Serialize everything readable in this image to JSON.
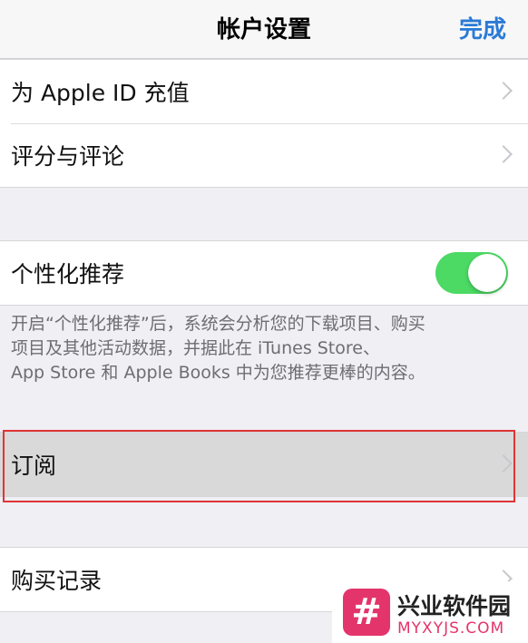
{
  "header": {
    "title": "帐户设置",
    "done_label": "完成"
  },
  "group1": {
    "items": [
      {
        "label": "为 Apple ID 充值"
      },
      {
        "label": "评分与评论"
      }
    ]
  },
  "personalize": {
    "label": "个性化推荐",
    "toggle_on": true,
    "toggle_color": "#4cd964",
    "footnote_lines": [
      "开启“个性化推荐”后，系统会分析您的下载项目、购买",
      "项目及其他活动数据，并据此在 iTunes Store、",
      "App Store 和 Apple Books 中为您推荐更棒的内容。"
    ]
  },
  "subscriptions": {
    "label": "订阅",
    "highlight_color": "#e03434"
  },
  "purchase_history": {
    "label": "购买记录"
  },
  "watermark": {
    "logo_symbol": "#",
    "title": "兴业软件园",
    "url": "MYXYJS.COM",
    "logo_color": "#e3356b"
  },
  "colors": {
    "accent": "#2a7ad6",
    "background": "#efeff4"
  }
}
